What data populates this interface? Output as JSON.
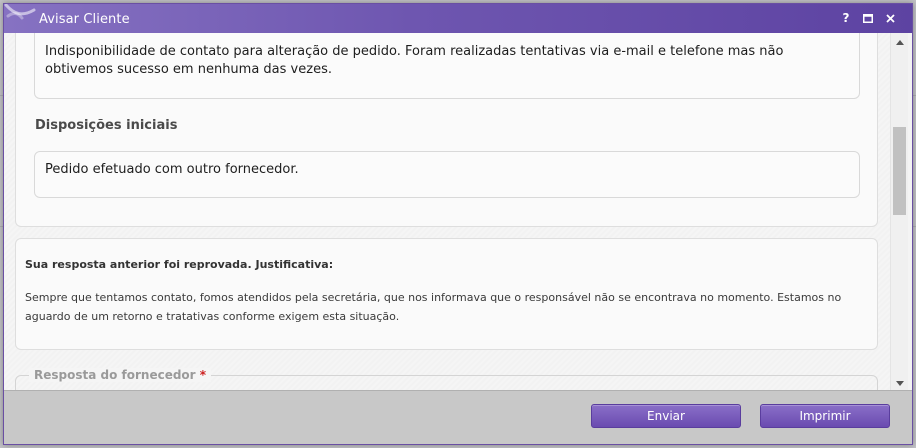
{
  "window": {
    "title": "Avisar Cliente",
    "help_label": "?",
    "maximize_label": "□",
    "close_label": "✕"
  },
  "previous_section": {
    "reason_text": "Indisponibilidade de contato para alteração de pedido. Foram realizadas tentativas via e-mail e telefone mas não obtivemos sucesso em nenhuma das vezes.",
    "initial_dispositions_heading": "Disposições iniciais",
    "initial_dispositions_text": "Pedido efetuado com outro fornecedor."
  },
  "rejection": {
    "heading": "Sua resposta anterior foi reprovada. Justificativa:",
    "text": "Sempre que tentamos contato, fomos atendidos pela secretária, que nos informava que o responsável não se encontrava no momento. Estamos no aguardo de um retorno e tratativas conforme exigem esta situação."
  },
  "supplier_response": {
    "legend": "Resposta do fornecedor",
    "required_mark": "*"
  },
  "footer": {
    "send_label": "Enviar",
    "print_label": "Imprimir"
  },
  "colors": {
    "titlebar": "#6e56b0",
    "button": "#7a5cbd",
    "required": "#cc2020"
  }
}
